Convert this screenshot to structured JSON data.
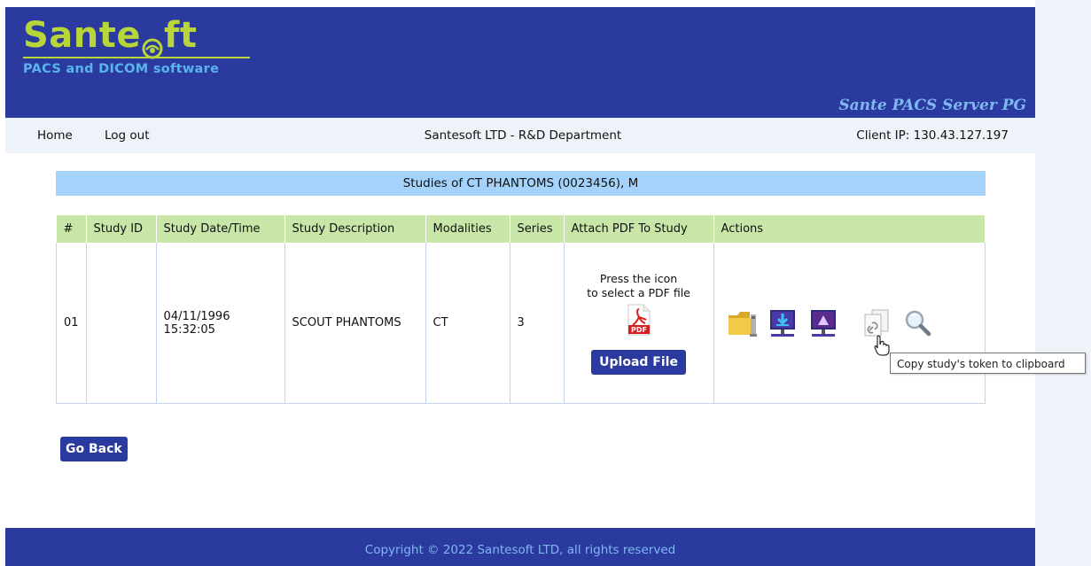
{
  "header": {
    "logo_text_1": "Sante",
    "logo_text_2": "ft",
    "logo_subtitle": "PACS and DICOM software",
    "product_name": "Sante PACS Server PG",
    "bg_color": "#2a3a9e",
    "logo_color": "#b8d63a"
  },
  "nav": {
    "home": "Home",
    "logout": "Log out",
    "center": "Santesoft LTD - R&D Department",
    "client_ip": "Client IP: 130.43.127.197"
  },
  "page_title": "Studies of CT PHANTOMS (0023456), M",
  "table": {
    "headers": [
      "#",
      "Study ID",
      "Study Date/Time",
      "Study Description",
      "Modalities",
      "Series",
      "Attach PDF To Study",
      "Actions"
    ],
    "rows": [
      {
        "num": "01",
        "study_id": "",
        "date": "04/11/1996",
        "time": "15:32:05",
        "description": "SCOUT PHANTOMS",
        "modalities": "CT",
        "series": "3",
        "attach_line1": "Press the icon",
        "attach_line2": "to select a PDF file",
        "pdf_label": "PDF",
        "upload_label": "Upload File"
      }
    ],
    "action_icons": [
      "folder-icon",
      "download-icon",
      "viewer-icon",
      "copy-token-icon",
      "search-icon"
    ]
  },
  "tooltip": "Copy study's token to clipboard",
  "go_back": "Go Back",
  "footer": "Copyright © 2022 Santesoft LTD, all rights reserved"
}
